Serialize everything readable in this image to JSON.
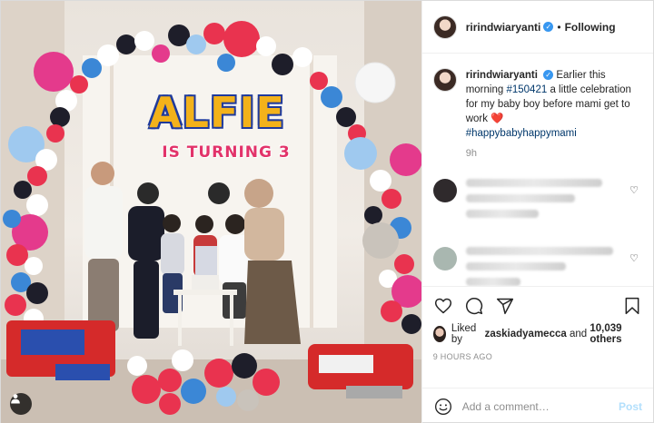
{
  "post": {
    "author": {
      "username": "ririndwiaryanti",
      "verified": true,
      "follow_state": "Following"
    },
    "image": {
      "banner_title": "ALFIE",
      "banner_subtitle": "IS TURNING 3"
    },
    "caption": {
      "username": "ririndwiaryanti",
      "text_before": "Earlier this morning",
      "hashtag_1": "#150421",
      "text_after": "a little celebration for my baby boy before mami get to work",
      "emoji": "❤️",
      "hashtag_2": "#happybabyhappymami",
      "time": "9h"
    },
    "comments": [
      {
        "avatar_color": "#2f2a2c",
        "blurred": true
      },
      {
        "avatar_color": "#a9b7b0",
        "blurred": true
      },
      {
        "avatar_color": "#4a3b33",
        "blurred": true
      }
    ],
    "likes": {
      "prefix": "Liked by",
      "liked_by_user": "zaskiadyamecca",
      "joiner": "and",
      "others": "10,039 others"
    },
    "posted_ago": "9 HOURS AGO",
    "comment_box": {
      "placeholder": "Add a comment…",
      "post_label": "Post"
    },
    "icons": {
      "like": "heart-icon",
      "comment": "comment-bubble-icon",
      "share": "paper-plane-icon",
      "save": "bookmark-icon",
      "emoji": "emoji-smile-icon",
      "tagged_users": "user-icon"
    },
    "colors": {
      "verified_blue": "#3897f0",
      "hashtag_blue": "#00376b",
      "heart_red": "#e0245e",
      "post_button_disabled": "#b2dffc"
    }
  }
}
